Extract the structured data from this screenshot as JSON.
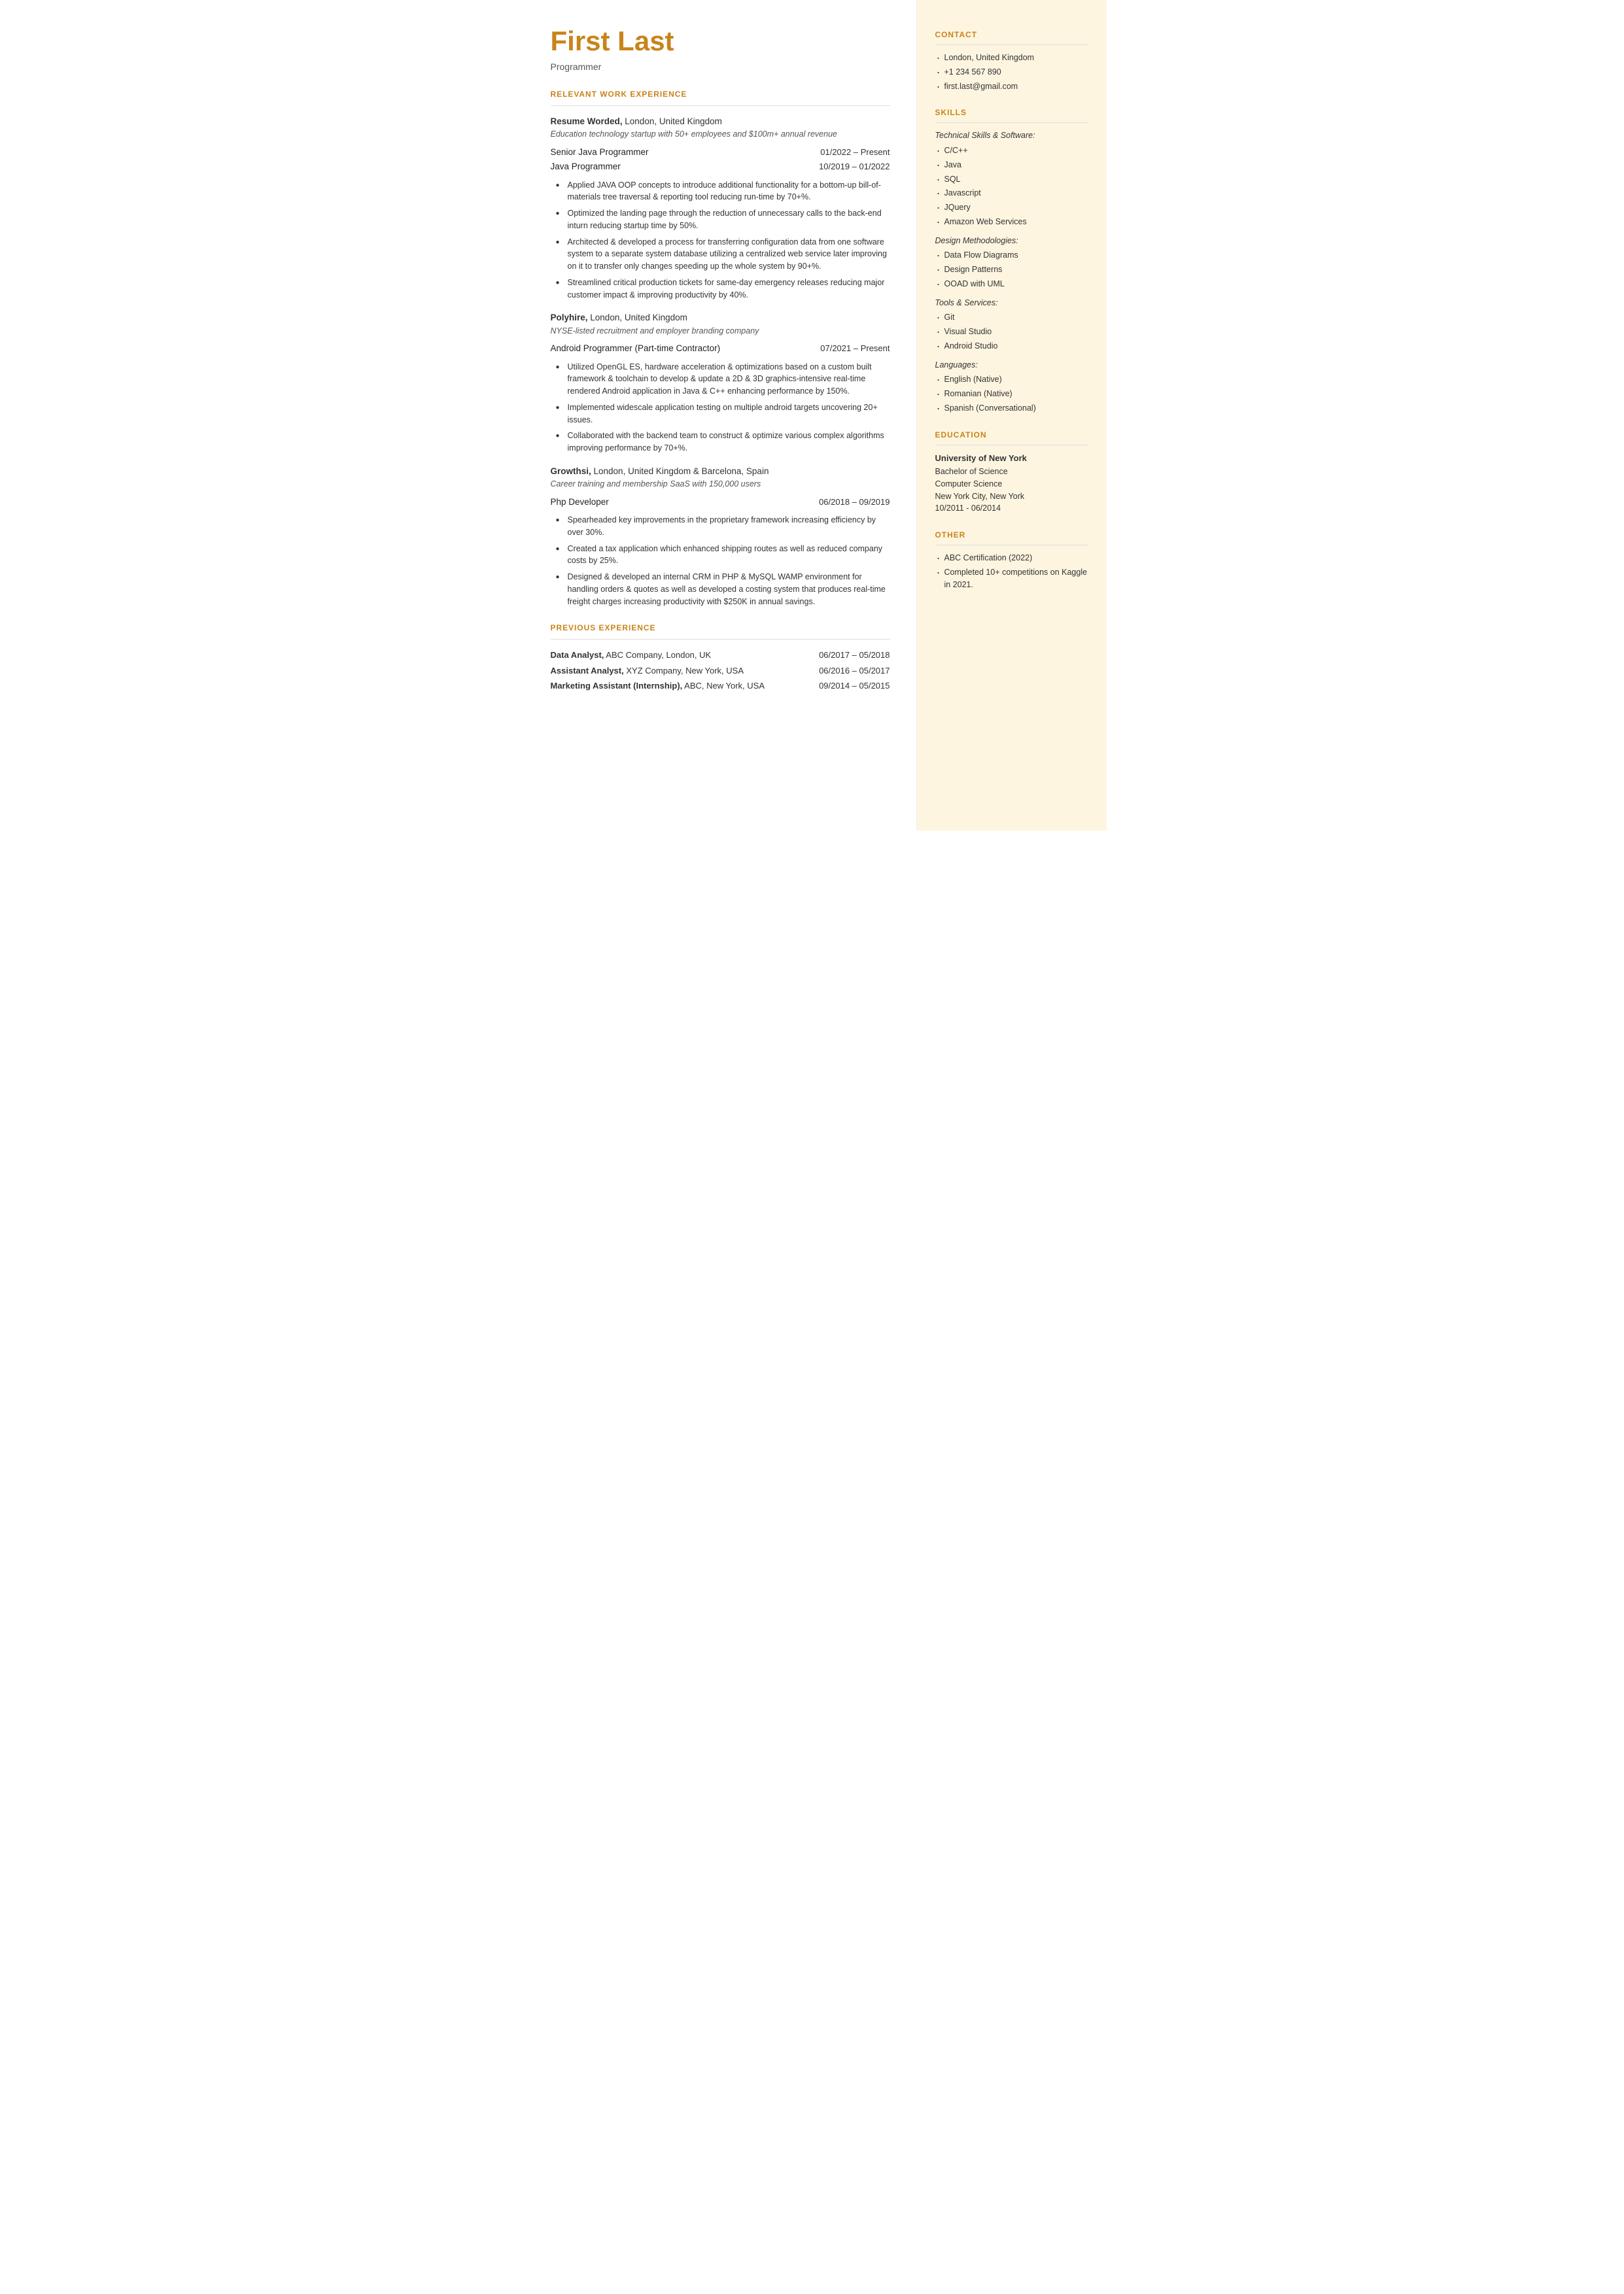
{
  "header": {
    "name": "First Last",
    "title": "Programmer"
  },
  "left": {
    "relevant_work_header": "RELEVANT WORK EXPERIENCE",
    "jobs": [
      {
        "company": "Resume Worded,",
        "location": " London, United Kingdom",
        "description": "Education technology startup with 50+ employees and $100m+ annual revenue",
        "positions": [
          {
            "title": "Senior Java Programmer",
            "date": "01/2022 – Present"
          },
          {
            "title": "Java Programmer",
            "date": "10/2019 – 01/2022"
          }
        ],
        "bullets": [
          "Applied JAVA OOP concepts to introduce additional functionality for a bottom-up bill-of-materials tree traversal & reporting tool reducing run-time by 70+%.",
          "Optimized the landing page through the reduction of unnecessary calls to the back-end inturn reducing startup time by 50%.",
          "Architected & developed a process for transferring configuration data from one software system to a separate system database utilizing a centralized web service later improving on it to transfer only changes speeding up the whole system by 90+%.",
          "Streamlined critical production tickets for same-day emergency releases reducing major customer impact & improving productivity by 40%."
        ]
      },
      {
        "company": "Polyhire,",
        "location": " London, United Kingdom",
        "description": "NYSE-listed recruitment and employer branding company",
        "positions": [
          {
            "title": "Android Programmer (Part-time Contractor)",
            "date": "07/2021 – Present"
          }
        ],
        "bullets": [
          "Utilized OpenGL ES, hardware acceleration & optimizations based on a custom built framework & toolchain to develop & update a 2D & 3D graphics-intensive real-time rendered Android application in Java & C++ enhancing performance by 150%.",
          "Implemented widescale application testing on multiple android targets uncovering 20+ issues.",
          "Collaborated with the backend team to construct & optimize various complex algorithms improving performance by 70+%."
        ]
      },
      {
        "company": "Growthsi,",
        "location": " London, United Kingdom & Barcelona, Spain",
        "description": "Career training and membership SaaS with 150,000 users",
        "positions": [
          {
            "title": "Php Developer",
            "date": "06/2018 – 09/2019"
          }
        ],
        "bullets": [
          "Spearheaded key improvements in the proprietary framework increasing efficiency by over 30%.",
          "Created a tax application which enhanced shipping routes as well as reduced company costs by 25%.",
          "Designed & developed an internal CRM in PHP & MySQL WAMP environment for handling orders & quotes as well as developed a costing system that produces real-time freight charges increasing productivity with $250K in annual savings."
        ]
      }
    ],
    "previous_exp_header": "PREVIOUS EXPERIENCE",
    "previous_jobs": [
      {
        "bold": "Data Analyst,",
        "rest": " ABC Company, London, UK",
        "date": "06/2017 – 05/2018"
      },
      {
        "bold": "Assistant Analyst,",
        "rest": " XYZ Company, New York, USA",
        "date": "06/2016 – 05/2017"
      },
      {
        "bold": "Marketing Assistant (Internship),",
        "rest": " ABC, New York, USA",
        "date": "09/2014 – 05/2015"
      }
    ]
  },
  "right": {
    "contact_header": "CONTACT",
    "contact_items": [
      "London, United Kingdom",
      "+1 234 567 890",
      "first.last@gmail.com"
    ],
    "skills_header": "SKILLS",
    "skills_categories": [
      {
        "label": "Technical Skills & Software:",
        "items": [
          "C/C++",
          "Java",
          "SQL",
          "Javascript",
          "JQuery",
          "Amazon Web Services"
        ]
      },
      {
        "label": "Design Methodologies:",
        "items": [
          "Data Flow Diagrams",
          "Design Patterns",
          "OOAD with UML"
        ]
      },
      {
        "label": "Tools & Services:",
        "items": [
          "Git",
          "Visual Studio",
          "Android Studio"
        ]
      },
      {
        "label": "Languages:",
        "items": [
          "English (Native)",
          "Romanian (Native)",
          "Spanish (Conversational)"
        ]
      }
    ],
    "education_header": "EDUCATION",
    "education": [
      {
        "school": "University of New York",
        "degree": "Bachelor of Science",
        "field": "Computer Science",
        "location": "New York City, New York",
        "dates": "10/2011 - 06/2014"
      }
    ],
    "other_header": "OTHER",
    "other_items": [
      "ABC Certification (2022)",
      "Completed 10+ competitions on Kaggle in 2021."
    ]
  }
}
